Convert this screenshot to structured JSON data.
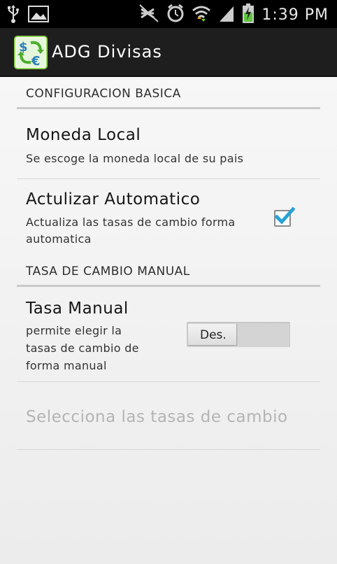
{
  "status_bar": {
    "time": "1:39 PM",
    "icons": [
      "usb-icon",
      "image-icon",
      "mute-icon",
      "alarm-icon",
      "wifi-icon",
      "signal-icon",
      "battery-charging-icon"
    ]
  },
  "action_bar": {
    "title": "ADG Divisas",
    "icon": "currency-exchange-icon"
  },
  "sections": {
    "basic": {
      "header": "CONFIGURACION BASICA",
      "moneda_local": {
        "title": "Moneda Local",
        "summary": "Se escoge la moneda local de su pais"
      },
      "actualizar": {
        "title": "Actulizar Automatico",
        "summary_line1": "Actualiza las tasas de cambio forma",
        "summary_line2": "automatica",
        "checked": true
      }
    },
    "manual": {
      "header": "TASA DE CAMBIO MANUAL",
      "tasa_manual": {
        "title": "Tasa Manual",
        "summary_line1": "permite elegir la",
        "summary_line2": "tasas de cambio de",
        "summary_line3": "forma manual",
        "toggle_label": "Des."
      },
      "selecciona": {
        "title": "Selecciona las tasas de cambio"
      }
    }
  },
  "colors": {
    "checkmark": "#2aa1d3",
    "action_bar": "#1e1e1e",
    "disabled_text": "#b4b4b4"
  }
}
